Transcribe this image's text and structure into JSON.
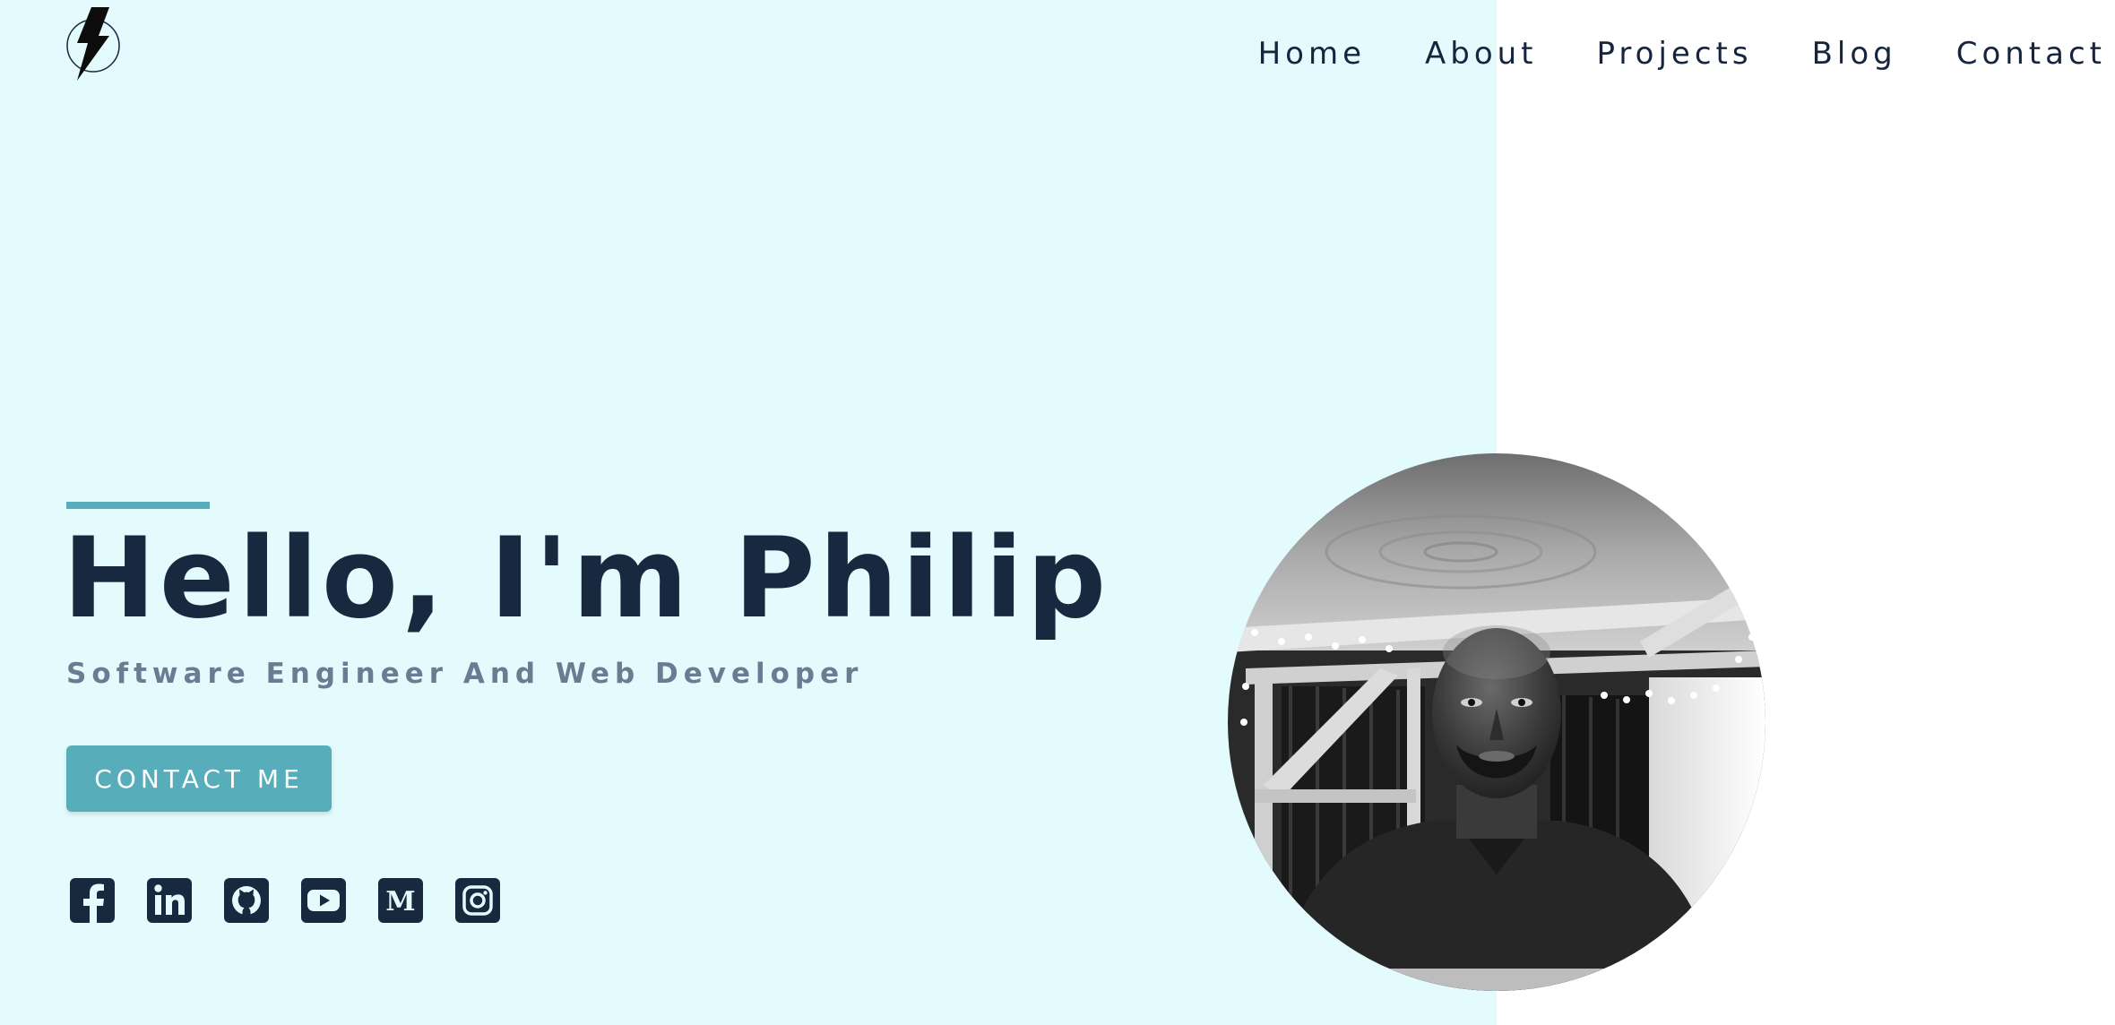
{
  "logo": {
    "icon": "lightning-bolt-icon"
  },
  "nav": {
    "items": [
      {
        "label": "Home"
      },
      {
        "label": "About"
      },
      {
        "label": "Projects"
      },
      {
        "label": "Blog"
      },
      {
        "label": "Contact"
      }
    ]
  },
  "hero": {
    "title": "Hello, I'm Philip",
    "subtitle": "Software Engineer And Web Developer",
    "cta_label": "CONTACT ME"
  },
  "social": {
    "items": [
      {
        "icon": "facebook-icon"
      },
      {
        "icon": "linkedin-icon"
      },
      {
        "icon": "github-icon"
      },
      {
        "icon": "youtube-icon"
      },
      {
        "icon": "medium-icon",
        "glyph": "M"
      },
      {
        "icon": "instagram-icon"
      }
    ]
  },
  "colors": {
    "left_background": "#e4fbfd",
    "accent": "#57adba",
    "heading": "#17283f",
    "subtitle": "#6b7c92"
  }
}
